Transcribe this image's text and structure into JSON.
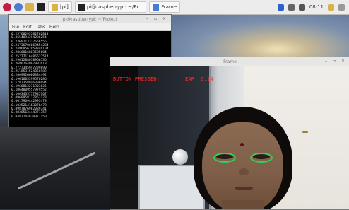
{
  "taskbar": {
    "tasks": [
      {
        "label": "[pi]"
      },
      {
        "label": "pi@raspberrypi: ~/Pr..."
      },
      {
        "label": "Frame"
      }
    ],
    "clock": "08:11"
  },
  "terminal": {
    "title": "pi@raspberrypi: ~/Project",
    "menu": [
      "File",
      "Edit",
      "Tabs",
      "Help"
    ],
    "lines": [
      "0.25760293782762814",
      "0.3654094394286254",
      "0.2360213312656556",
      "0.24736706669454284",
      "0.24960567950346104",
      "0.2866016803585604",
      "0.25777116486622514",
      "0.2961288078966536",
      "0.2686764907992618",
      "0.2727345947299890",
      "0.2518531524856989",
      "0.2609926606384492",
      "0.1961605399570286",
      "0.1787358846398094",
      "0.1966813231903625",
      "0.1064809557979552",
      "0.1003435757935767",
      "0.0960958117863178",
      "0.0617969442993478",
      "0.1035214163076478",
      "0.0987876982089741",
      "0.0836563444371757",
      "0.0487244830077150"
    ]
  },
  "frame": {
    "title": "Frame",
    "overlay_left": "BUTTON PRESSED!",
    "overlay_right": "EAR: 0.14"
  },
  "colors": {
    "overlay_text": "#ff2a2a",
    "eye_contour": "#2fd15a",
    "terminal_bg": "#000000"
  }
}
